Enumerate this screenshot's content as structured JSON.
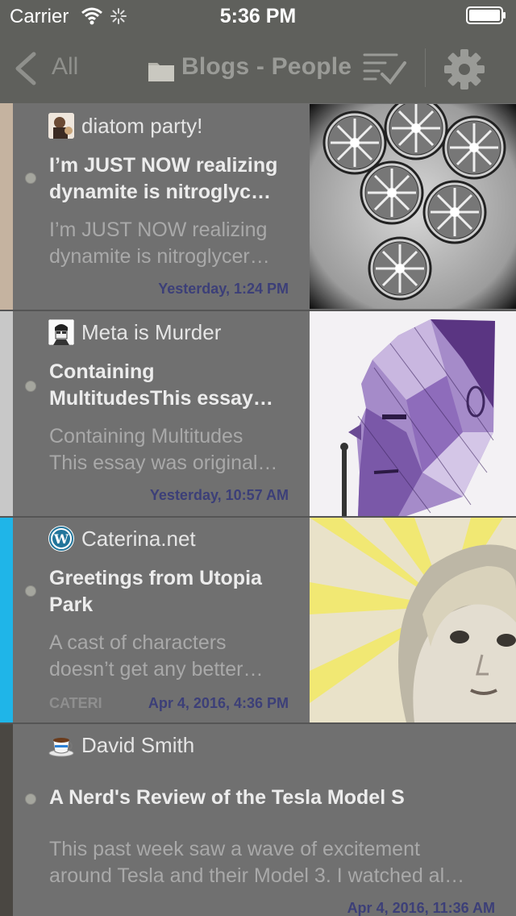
{
  "status_bar": {
    "carrier": "Carrier",
    "time": "5:36 PM"
  },
  "nav": {
    "back_label": "All",
    "title": "Blogs - People",
    "icons": [
      "chevron-left-icon",
      "folder-icon",
      "mark-read-icon",
      "gear-icon"
    ]
  },
  "colors": {
    "story_background": "#707070",
    "date": "#3c3f78",
    "feed_bar_story_1": "#c5b3a0",
    "feed_bar_story_2": "#c8c8c8",
    "feed_bar_story_3": "#1fb5e8",
    "feed_bar_story_4": "#4a4742"
  },
  "stories": [
    {
      "feed": "diatom party!",
      "title_lines": [
        "I’m JUST NOW realizing",
        "dynamite is nitroglyc…"
      ],
      "content_lines": [
        "I’m JUST NOW realizing",
        "dynamite is nitroglycer…"
      ],
      "author": "",
      "date": "Yesterday, 1:24 PM",
      "image": "diatoms-image"
    },
    {
      "feed": "Meta is Murder",
      "title_lines": [
        "Containing",
        "MultitudesThis essay…"
      ],
      "content_lines": [
        "Containing Multitudes",
        "This essay was original…"
      ],
      "author": "",
      "date": "Yesterday, 10:57 AM",
      "image": "purple-head-illustration"
    },
    {
      "feed": "Caterina.net",
      "title_lines": [
        "Greetings from Utopia",
        "Park"
      ],
      "content_lines": [
        "A cast of characters",
        "doesn’t get any better…"
      ],
      "author": "CATERI",
      "date": "Apr 4, 2016, 4:36 PM",
      "image": "child-portrait-photo"
    },
    {
      "feed": "David Smith",
      "title_lines": [
        "A Nerd's Review of the Tesla Model S"
      ],
      "content_lines": [
        "This past week saw a wave of excitement",
        "around Tesla and their Model 3. I watched al…"
      ],
      "author": "",
      "date": "Apr 4, 2016, 11:36 AM",
      "image": ""
    }
  ]
}
